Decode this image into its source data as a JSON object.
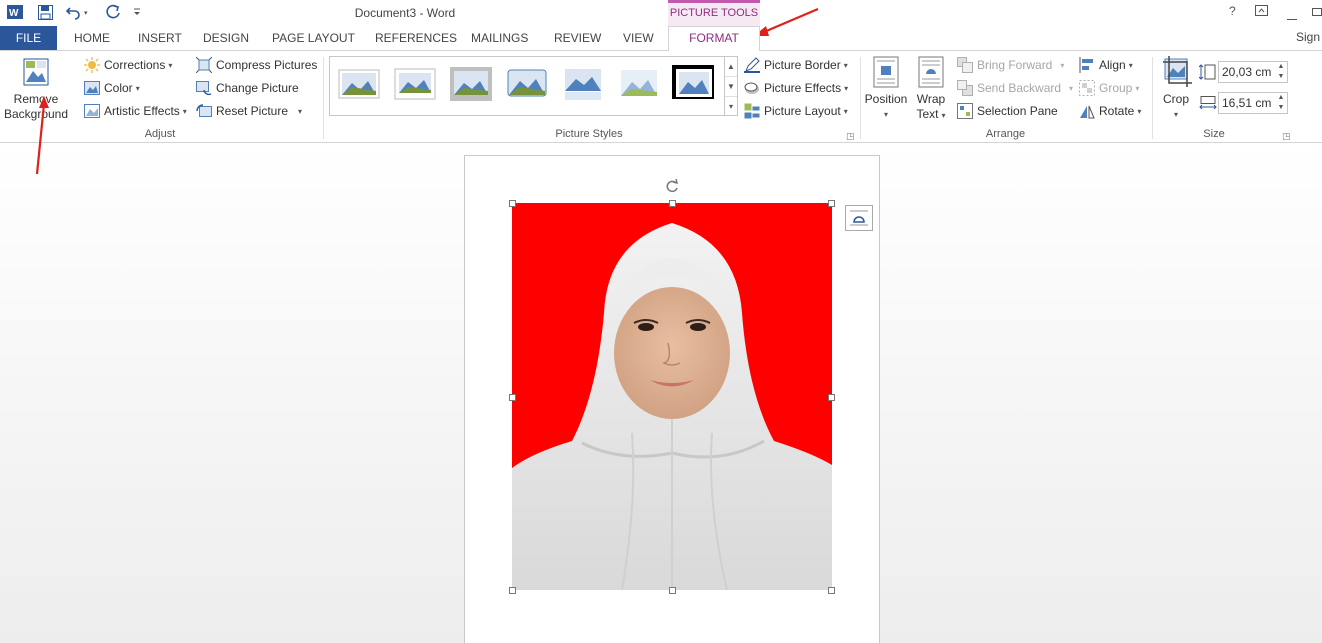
{
  "window": {
    "title": "Document3 - Word",
    "contextual_group": "PICTURE TOOLS",
    "help": "?",
    "sign_in": "Sign"
  },
  "tabs": {
    "file": "FILE",
    "items": [
      "HOME",
      "INSERT",
      "DESIGN",
      "PAGE LAYOUT",
      "REFERENCES",
      "MAILINGS",
      "REVIEW",
      "VIEW"
    ],
    "active": "FORMAT"
  },
  "ribbon": {
    "adjust": {
      "label": "Adjust",
      "remove_bg_line1": "Remove",
      "remove_bg_line2": "Background",
      "corrections": "Corrections",
      "color": "Color",
      "artistic_effects": "Artistic Effects",
      "compress": "Compress Pictures",
      "change": "Change Picture",
      "reset": "Reset Picture"
    },
    "styles": {
      "label": "Picture Styles",
      "border": "Picture Border",
      "effects": "Picture Effects",
      "layout": "Picture Layout"
    },
    "arrange": {
      "label": "Arrange",
      "position": "Position",
      "wrap_line1": "Wrap",
      "wrap_line2": "Text",
      "bring_forward": "Bring Forward",
      "send_backward": "Send Backward",
      "selection_pane": "Selection Pane",
      "align": "Align",
      "group": "Group",
      "rotate": "Rotate"
    },
    "size": {
      "label": "Size",
      "crop": "Crop",
      "height": "20,03 cm",
      "width": "16,51 cm"
    }
  },
  "colors": {
    "file_tab": "#2b579a",
    "contextual": "#c25ab0",
    "annotation": "#e0201b",
    "photo_bg": "#ff0000"
  }
}
